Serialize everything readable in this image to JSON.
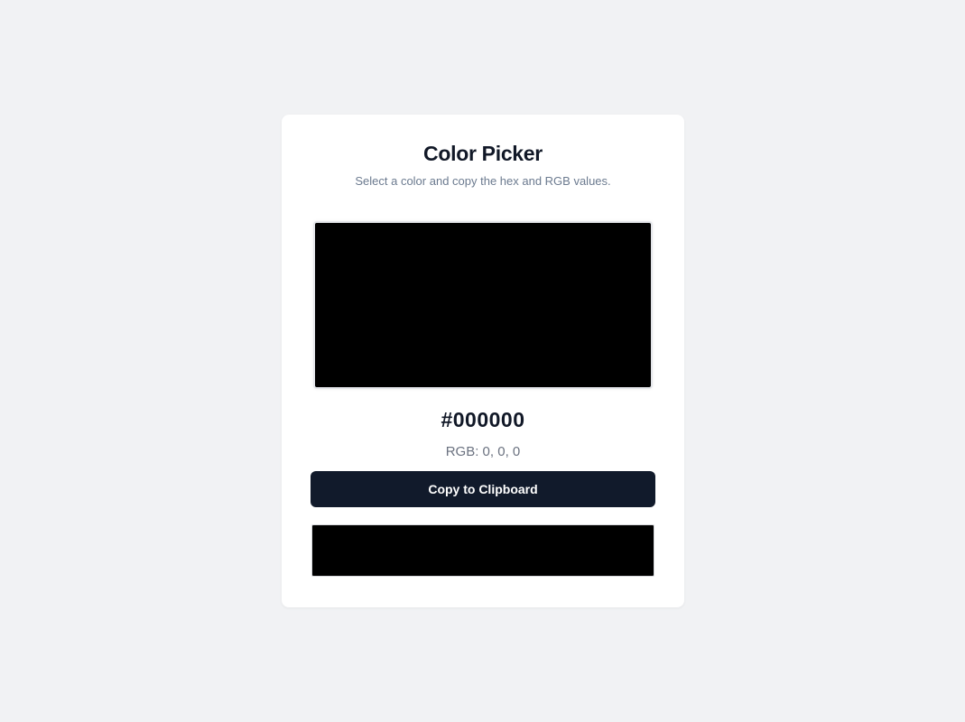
{
  "header": {
    "title": "Color Picker",
    "subtitle": "Select a color and copy the hex and RGB values."
  },
  "color": {
    "preview_color": "#000000",
    "hex_label": "#000000",
    "rgb_label": "RGB: 0, 0, 0"
  },
  "actions": {
    "copy_label": "Copy to Clipboard"
  },
  "theme": {
    "page_background": "#f1f2f4",
    "card_background": "#ffffff",
    "button_background": "#111a2b"
  }
}
